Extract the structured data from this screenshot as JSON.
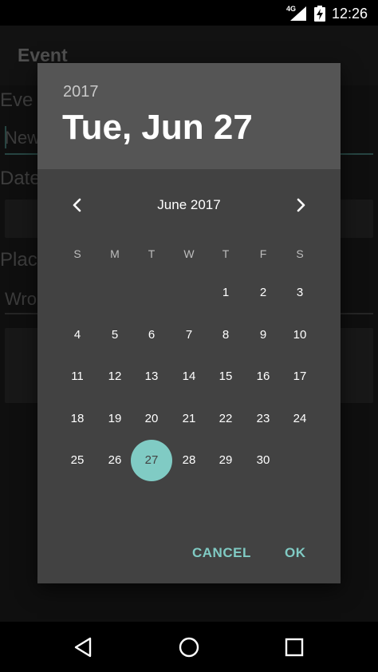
{
  "status_bar": {
    "network": "4G",
    "time": "12:26"
  },
  "background_app": {
    "title": "Event",
    "field_labels": [
      "Eve",
      "Date",
      "Plac"
    ],
    "event_name_placeholder": "New",
    "place_value": "Wro"
  },
  "dialog": {
    "header_year": "2017",
    "header_date": "Tue, Jun 27",
    "month_label": "June 2017",
    "weekdays": [
      "S",
      "M",
      "T",
      "W",
      "T",
      "F",
      "S"
    ],
    "weeks": [
      [
        "",
        "",
        "",
        "",
        "1",
        "2",
        "3"
      ],
      [
        "4",
        "5",
        "6",
        "7",
        "8",
        "9",
        "10"
      ],
      [
        "11",
        "12",
        "13",
        "14",
        "15",
        "16",
        "17"
      ],
      [
        "18",
        "19",
        "20",
        "21",
        "22",
        "23",
        "24"
      ],
      [
        "25",
        "26",
        "27",
        "28",
        "29",
        "30",
        ""
      ]
    ],
    "selected_day": "27",
    "cancel_label": "CANCEL",
    "ok_label": "OK",
    "accent_color": "#80cbc4"
  },
  "icons": {
    "prev_month": "chevron-left-icon",
    "next_month": "chevron-right-icon",
    "back": "back-icon",
    "home": "home-icon",
    "recents": "recents-icon"
  }
}
